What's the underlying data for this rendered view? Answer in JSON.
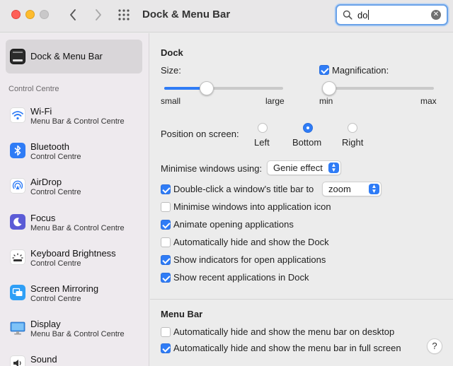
{
  "window": {
    "title": "Dock & Menu Bar"
  },
  "search": {
    "value": "do"
  },
  "sidebar": {
    "selected": {
      "label": "Dock & Menu Bar"
    },
    "section_header": "Control Centre",
    "items": [
      {
        "title": "Wi-Fi",
        "subtitle": "Menu Bar & Control Centre",
        "icon": "wifi-icon"
      },
      {
        "title": "Bluetooth",
        "subtitle": "Control Centre",
        "icon": "bluetooth-icon"
      },
      {
        "title": "AirDrop",
        "subtitle": "Control Centre",
        "icon": "airdrop-icon"
      },
      {
        "title": "Focus",
        "subtitle": "Menu Bar & Control Centre",
        "icon": "moon-icon"
      },
      {
        "title": "Keyboard Brightness",
        "subtitle": "Control Centre",
        "icon": "keyboard-brightness-icon"
      },
      {
        "title": "Screen Mirroring",
        "subtitle": "Control Centre",
        "icon": "screen-mirroring-icon"
      },
      {
        "title": "Display",
        "subtitle": "Menu Bar & Control Centre",
        "icon": "display-icon"
      },
      {
        "title": "Sound",
        "subtitle": "",
        "icon": "sound-icon"
      }
    ]
  },
  "dock": {
    "header": "Dock",
    "size_label": "Size:",
    "size_min": "small",
    "size_max": "large",
    "size_value": 0.36,
    "magnification_label": "Magnification:",
    "magnification_checked": true,
    "mag_min": "min",
    "mag_max": "max",
    "mag_value": 0.0,
    "position_label": "Position on screen:",
    "positions": [
      "Left",
      "Bottom",
      "Right"
    ],
    "position_selected": "Bottom",
    "minimise_label": "Minimise windows using:",
    "minimise_value": "Genie effect",
    "double_click_label": "Double-click a window's title bar to",
    "double_click_value": "zoom",
    "options": [
      {
        "label": "Minimise windows into application icon",
        "checked": false
      },
      {
        "label": "Animate opening applications",
        "checked": true
      },
      {
        "label": "Automatically hide and show the Dock",
        "checked": false
      },
      {
        "label": "Show indicators for open applications",
        "checked": true
      },
      {
        "label": "Show recent applications in Dock",
        "checked": true
      }
    ]
  },
  "menubar": {
    "header": "Menu Bar",
    "options": [
      {
        "label": "Automatically hide and show the menu bar on desktop",
        "checked": false
      },
      {
        "label": "Automatically hide and show the menu bar in full screen",
        "checked": true
      }
    ]
  },
  "help": {
    "label": "?"
  },
  "colors": {
    "accent": "#2f7cf6"
  }
}
